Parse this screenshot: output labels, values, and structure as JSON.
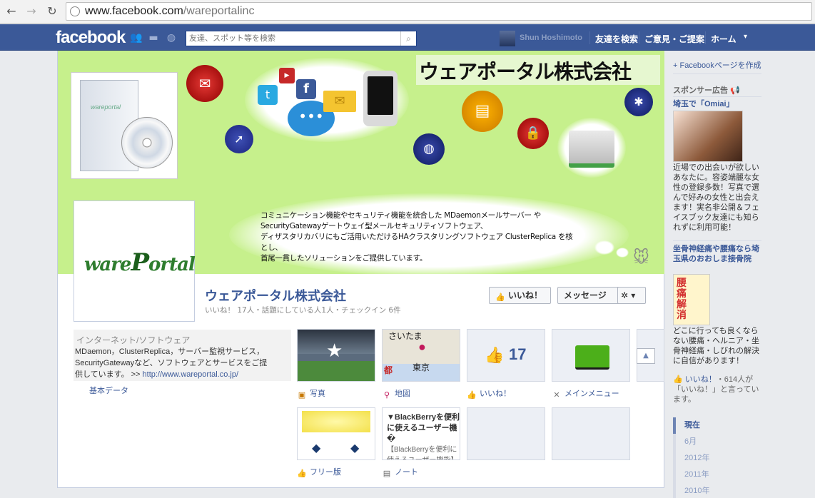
{
  "browser": {
    "url_host": "www.facebook.com",
    "url_path": "/wareportalinc"
  },
  "fbbar": {
    "logo": "facebook",
    "search_placeholder": "友達、スポット等を検索",
    "user_name": "Shun Hoshimoto",
    "find_friends": "友達を検索",
    "feedback": "ご意見・ご提案",
    "home": "ホーム"
  },
  "cover": {
    "title": "ウェアポータル株式会社",
    "box_label": "wareportal",
    "description_lines": [
      "コミュニケーション機能やセキュリティ機能を統合した MDaemonメールサーバー や",
      "SecurityGatewayゲートウェイ型メールセキュリティソフトウェア、",
      "ディザスタリカバリにもご活用いただけるHAクラスタリングソフトウェア ClusterReplica を核とし、",
      "首尾一貫したソリューションをご提供しています。"
    ]
  },
  "profile": {
    "logo_a": "ware",
    "logo_b": "P",
    "logo_c": "ortal",
    "name": "ウェアポータル株式会社",
    "stats": "いいね！ 17人・話題にしている人1人・チェックイン 6件",
    "like_button": "いいね！",
    "message_button": "メッセージ",
    "gear_button": "✲ ▾"
  },
  "about": {
    "category": "インターネット/ソフトウェア",
    "desc": "MDaemon，ClusterReplica，サーバー監視サービス，SecurityGatewayなど、ソフトウェアとサービスをご提供しています。 >> ",
    "link": "http://www.wareportal.co.jp/",
    "basic_data": "基本データ"
  },
  "tiles": {
    "photos": "写真",
    "map": "地図",
    "map_city1": "さいたま",
    "map_city2": "東京",
    "map_city3": "都",
    "likes": "いいね！",
    "likes_count": "17",
    "main_menu": "メインメニュー",
    "free": "フリー版",
    "notes": "ノート",
    "note_title": "▼BlackBerryを便利に使えるユーザー機�",
    "note_body": "【BlackBerryを便利に使えるユーザー機能】に"
  },
  "right": {
    "create_page": "+ Facebookページを作成",
    "sponsored": "スポンサー広告",
    "ad1_title": "埼玉で「Omiai」",
    "ad1_text": "近場での出会いが欲しいあなたに。容姿端麗な女性の登録多数！写真で選んで好みの女性と出会えます！実名非公開＆フェイスブック友達にも知られずに利用可能！",
    "ad2_title": "坐骨神経痛や腰痛なら埼玉県のおおしま接骨院",
    "ad2_img_text": "腰痛解消",
    "ad2_text": "どこに行っても良くならない腰痛・ヘルニア・坐骨神経痛・しびれの解決に自信があります！",
    "ad2_like": "いいね！",
    "ad2_like_rest": "・614人が「いいね！」と言っています。",
    "timeline": [
      "現在",
      "6月",
      "2012年",
      "2011年",
      "2010年"
    ]
  },
  "colors": {
    "fb_blue": "#3b5998",
    "cover_green": "#c6f08c",
    "link": "#3b5998"
  }
}
